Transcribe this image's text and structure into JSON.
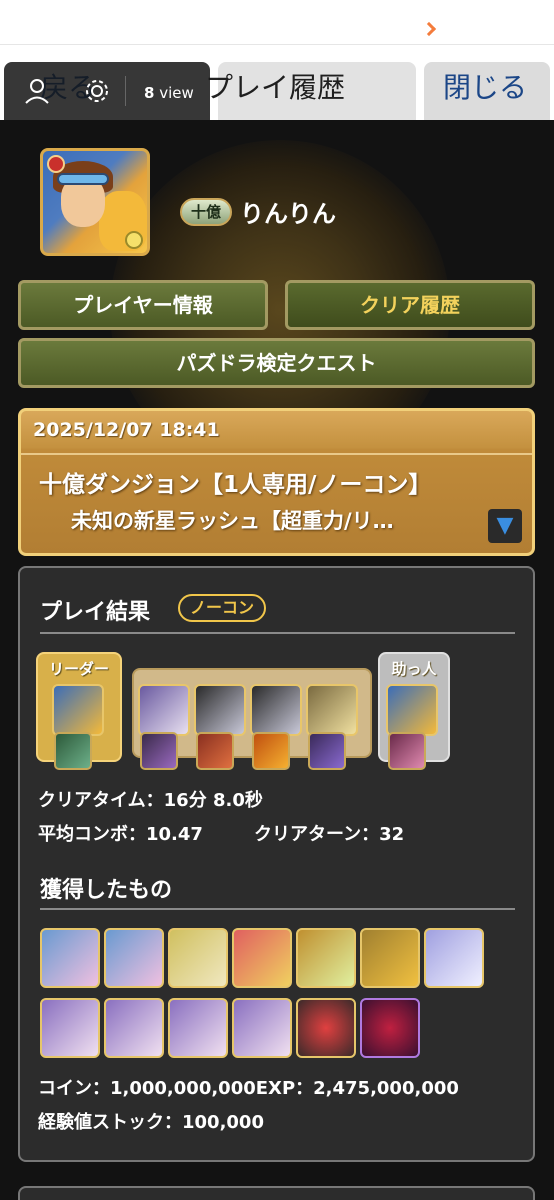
{
  "header": {
    "back_label": "戻る",
    "title": "プレイ履歴",
    "close_label": "閉じる",
    "view_count": "8",
    "view_unit": "view"
  },
  "player": {
    "rank_badge": "十億",
    "name": "りんりん"
  },
  "nav": {
    "player_info": "プレイヤー情報",
    "clear_history": "クリア履歴",
    "certification": "パズドラ検定クエスト"
  },
  "history": {
    "datetime": "2025/12/07 18:41",
    "dungeon": "十億ダンジョン【1人専用/ノーコン】",
    "floor": "未知の新星ラッシュ【超重力/リ…",
    "toggle_icon": "▼"
  },
  "result": {
    "title": "プレイ結果",
    "badge": "ノーコン",
    "leader_label": "リーダー",
    "helper_label": "助っ人",
    "clear_time": "クリアタイム：16分 8.0秒",
    "avg_combo": "平均コンボ：10.47",
    "clear_turn": "クリアターン：32",
    "obtained_title": "獲得したもの",
    "coin": "コイン：1,000,000,000",
    "exp": "EXP：2,475,000,000",
    "exp_stock": "経験値ストック：100,000"
  },
  "colors": {
    "background": "#121212",
    "card": "#2c2c2c",
    "gold": "#f1c64a",
    "link_blue": "#1d4f9c"
  }
}
